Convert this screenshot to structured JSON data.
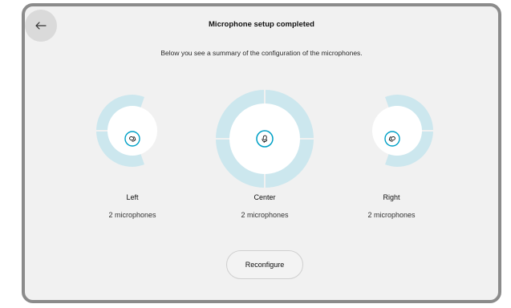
{
  "header": {
    "title": "Microphone setup completed",
    "subtitle": "Below you see a summary of the configuration of the microphones."
  },
  "icons": {
    "back": "arrow-left-icon",
    "mic_rotated": "microphone-icon"
  },
  "colors": {
    "ring": "#cce7ee",
    "accent": "#00a0c6",
    "background": "#f1f1f1"
  },
  "groups": [
    {
      "label": "Left",
      "count_text": "2 microphones"
    },
    {
      "label": "Center",
      "count_text": "2 microphones"
    },
    {
      "label": "Right",
      "count_text": "2 microphones"
    }
  ],
  "actions": {
    "reconfigure_label": "Reconfigure"
  }
}
